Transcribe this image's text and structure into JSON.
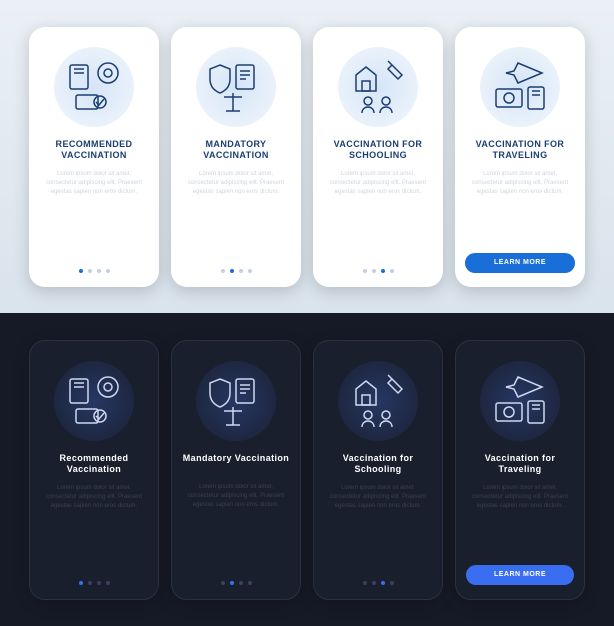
{
  "placeholder": "Lorem ipsum dolor sit amet, consectetur adipiscing elit. Praesent egestas sapien non eros dictum.",
  "cta_label": "LEARN MORE",
  "icons": [
    "recommended-icon",
    "mandatory-icon",
    "schooling-icon",
    "traveling-icon"
  ],
  "light": {
    "cards": [
      {
        "title": "RECOMMENDED VACCINATION"
      },
      {
        "title": "MANDATORY VACCINATION"
      },
      {
        "title": "VACCINATION FOR SCHOOLING"
      },
      {
        "title": "VACCINATION FOR TRAVELING"
      }
    ]
  },
  "dark": {
    "cards": [
      {
        "title": "Recommended Vaccination"
      },
      {
        "title": "Mandatory Vaccination"
      },
      {
        "title": "Vaccination for Schooling"
      },
      {
        "title": "Vaccination for Traveling"
      }
    ]
  }
}
